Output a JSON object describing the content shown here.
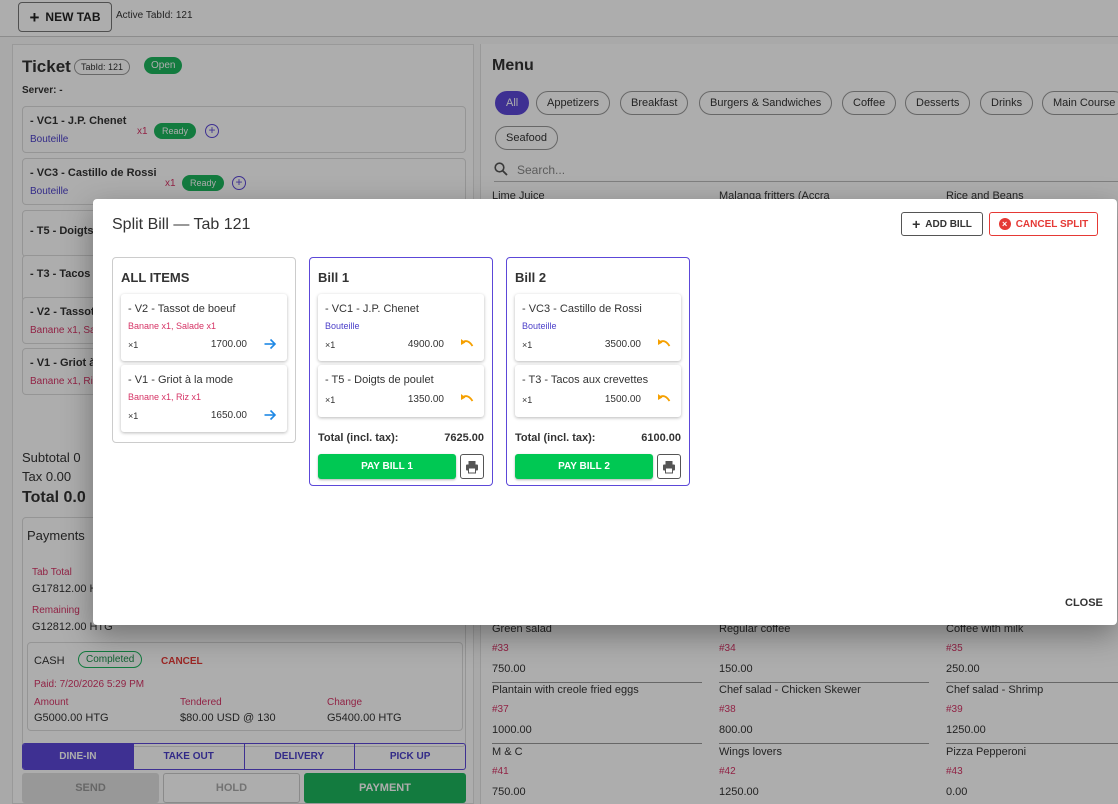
{
  "topbar": {
    "new_tab_label": "NEW TAB",
    "active_tab_text": "Active TabId: 121"
  },
  "ticket": {
    "title": "Ticket",
    "tab_chip": "TabId: 121",
    "status_chip": "Open",
    "server": "Server: -",
    "lines": [
      {
        "name": "- VC1 - J.P. Chenet",
        "sub": "Bouteille",
        "qty": "x1",
        "status": "Ready"
      },
      {
        "name": "- VC3 - Castillo de Rossi",
        "sub": "Bouteille",
        "qty": "x1",
        "status": "Ready"
      },
      {
        "name": "- T5 - Doigts",
        "sub": ""
      },
      {
        "name": "- T3 - Tacos",
        "sub": ""
      },
      {
        "name": "- V2 - Tassot",
        "sub": "Banane x1, Sa"
      },
      {
        "name": "- V1 - Griot à",
        "sub": "Banane x1, Riz"
      }
    ],
    "subtotal": "Subtotal  0",
    "tax": "Tax   0.00",
    "total": "Total  0.0"
  },
  "payments": {
    "title": "Payments",
    "tab_total_label": "Tab Total",
    "tab_total_value": "G17812.00 H",
    "remaining_label": "Remaining",
    "remaining_value": "G12812.00 HTG",
    "cash": {
      "method": "CASH",
      "status": "Completed",
      "cancel": "CANCEL",
      "paid": "Paid: 7/20/2026 5:29 PM",
      "amount_label": "Amount",
      "amount_value": "G5000.00 HTG",
      "tendered_label": "Tendered",
      "tendered_value": "$80.00 USD @ 130",
      "change_label": "Change",
      "change_value": "G5400.00 HTG"
    }
  },
  "order_types": [
    "DINE-IN",
    "TAKE OUT",
    "DELIVERY",
    "PICK UP"
  ],
  "actions": {
    "send": "SEND",
    "hold": "HOLD",
    "payment": "PAYMENT"
  },
  "menu": {
    "title": "Menu",
    "categories": [
      "All",
      "Appetizers",
      "Breakfast",
      "Burgers & Sandwiches",
      "Coffee",
      "Desserts",
      "Drinks",
      "Main Course",
      "Seafood"
    ],
    "search_placeholder": "Search...",
    "top_items": [
      "Lime Juice",
      "Malanga fritters (Accra",
      "Rice and Beans"
    ],
    "items": [
      {
        "name": "Green salad",
        "id": "#33",
        "price": "750.00"
      },
      {
        "name": "Regular coffee",
        "id": "#34",
        "price": "150.00"
      },
      {
        "name": "Coffee with milk",
        "id": "#35",
        "price": "250.00"
      },
      {
        "name": "Plantain with creole fried eggs",
        "id": "#37",
        "price": "1000.00"
      },
      {
        "name": "Chef salad - Chicken Skewer",
        "id": "#38",
        "price": "800.00"
      },
      {
        "name": "Chef salad - Shrimp",
        "id": "#39",
        "price": "1250.00"
      },
      {
        "name": "M & C",
        "id": "#41",
        "price": "750.00"
      },
      {
        "name": "Wings lovers",
        "id": "#42",
        "price": "1250.00"
      },
      {
        "name": "Pizza Pepperoni",
        "id": "#43",
        "price": "0.00"
      }
    ]
  },
  "modal": {
    "title": "Split Bill — Tab 121",
    "add_bill": "ADD BILL",
    "cancel_split": "CANCEL SPLIT",
    "close": "CLOSE",
    "all_items": {
      "title": "ALL ITEMS",
      "items": [
        {
          "name": "- V2 - Tassot de boeuf",
          "sub": "Banane x1, Salade x1",
          "qty": "×1",
          "price": "1700.00"
        },
        {
          "name": "- V1 - Griot à la mode",
          "sub": "Banane x1, Riz x1",
          "qty": "×1",
          "price": "1650.00"
        }
      ]
    },
    "bills": [
      {
        "title": "Bill 1",
        "items": [
          {
            "name": "- VC1 - J.P. Chenet",
            "sub": "Bouteille",
            "qty": "×1",
            "price": "4900.00"
          },
          {
            "name": "- T5 - Doigts de poulet",
            "sub": "",
            "qty": "×1",
            "price": "1350.00"
          }
        ],
        "total_label": "Total (incl. tax):",
        "total_value": "7625.00",
        "pay_label": "PAY BILL 1"
      },
      {
        "title": "Bill 2",
        "items": [
          {
            "name": "- VC3 - Castillo de Rossi",
            "sub": "Bouteille",
            "qty": "×1",
            "price": "3500.00"
          },
          {
            "name": "- T3 - Tacos aux crevettes",
            "sub": "",
            "qty": "×1",
            "price": "1500.00"
          }
        ],
        "total_label": "Total (incl. tax):",
        "total_value": "6100.00",
        "pay_label": "PAY BILL 2"
      }
    ]
  },
  "colors": {
    "primary": "#5c48d8",
    "success": "#1db55e",
    "pay_button": "#00c853",
    "danger": "#e53935",
    "modifier_pink": "#d63466",
    "move_arrow": "#1e88e5",
    "undo_orange": "#f5a000"
  },
  "icons": {
    "new_tab": "plus-icon",
    "add_item": "plus-circle-icon",
    "search": "search-icon",
    "move": "arrow-right-icon",
    "return": "undo-icon",
    "print": "printer-icon",
    "cancel": "close-circle-icon"
  }
}
